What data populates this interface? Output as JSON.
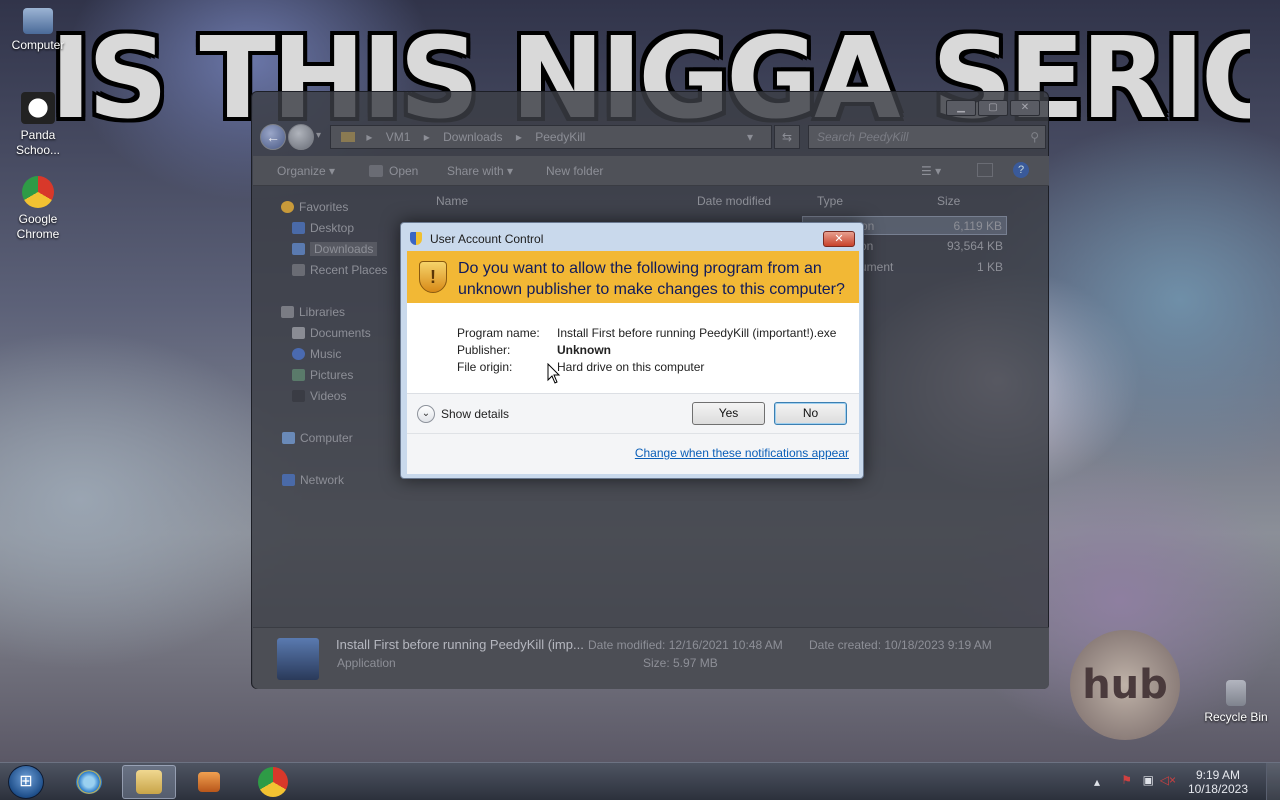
{
  "wallpaper": {
    "meme_text": "IS THIS NIGGA SERIOUS?",
    "logo_text": "hub"
  },
  "desktop_icons": [
    {
      "label": "Computer"
    },
    {
      "label": "Panda Schoo..."
    },
    {
      "label": "Google Chrome"
    },
    {
      "label": "Recycle Bin"
    }
  ],
  "explorer": {
    "breadcrumb": [
      "VM1",
      "Downloads",
      "PeedyKill"
    ],
    "search_placeholder": "Search PeedyKill",
    "toolbar": {
      "organize": "Organize ▾",
      "open": "Open",
      "share_with": "Share with ▾",
      "new_folder": "New folder"
    },
    "nav_pane": {
      "favorites": "Favorites",
      "desktop": "Desktop",
      "downloads": "Downloads",
      "recent_places": "Recent Places",
      "libraries": "Libraries",
      "documents": "Documents",
      "music": "Music",
      "pictures": "Pictures",
      "videos": "Videos",
      "computer": "Computer",
      "network": "Network"
    },
    "columns": {
      "name": "Name",
      "date_modified": "Date modified",
      "type": "Type",
      "size": "Size"
    },
    "rows": [
      {
        "type": "on",
        "size": "6,119 KB"
      },
      {
        "type": "on",
        "size": "93,564 KB"
      },
      {
        "type": "ument",
        "size": "1 KB"
      }
    ],
    "details": {
      "filename": "Install First before running PeedyKill (imp...",
      "filetype": "Application",
      "date_modified": "Date modified: 12/16/2021 10:48 AM",
      "size": "Size: 5.97 MB",
      "date_created": "Date created: 10/18/2023 9:19 AM"
    }
  },
  "uac": {
    "title": "User Account Control",
    "question": "Do you want to allow the following program from an unknown publisher to make changes to this computer?",
    "program_name_label": "Program name:",
    "program_name": "Install First before running PeedyKill (important!).exe",
    "publisher_label": "Publisher:",
    "publisher": "Unknown",
    "file_origin_label": "File origin:",
    "file_origin": "Hard drive on this computer",
    "show_details": "Show details",
    "yes": "Yes",
    "no": "No",
    "change_link": "Change when these notifications appear"
  },
  "taskbar": {
    "time": "9:19 AM",
    "date": "10/18/2023"
  }
}
